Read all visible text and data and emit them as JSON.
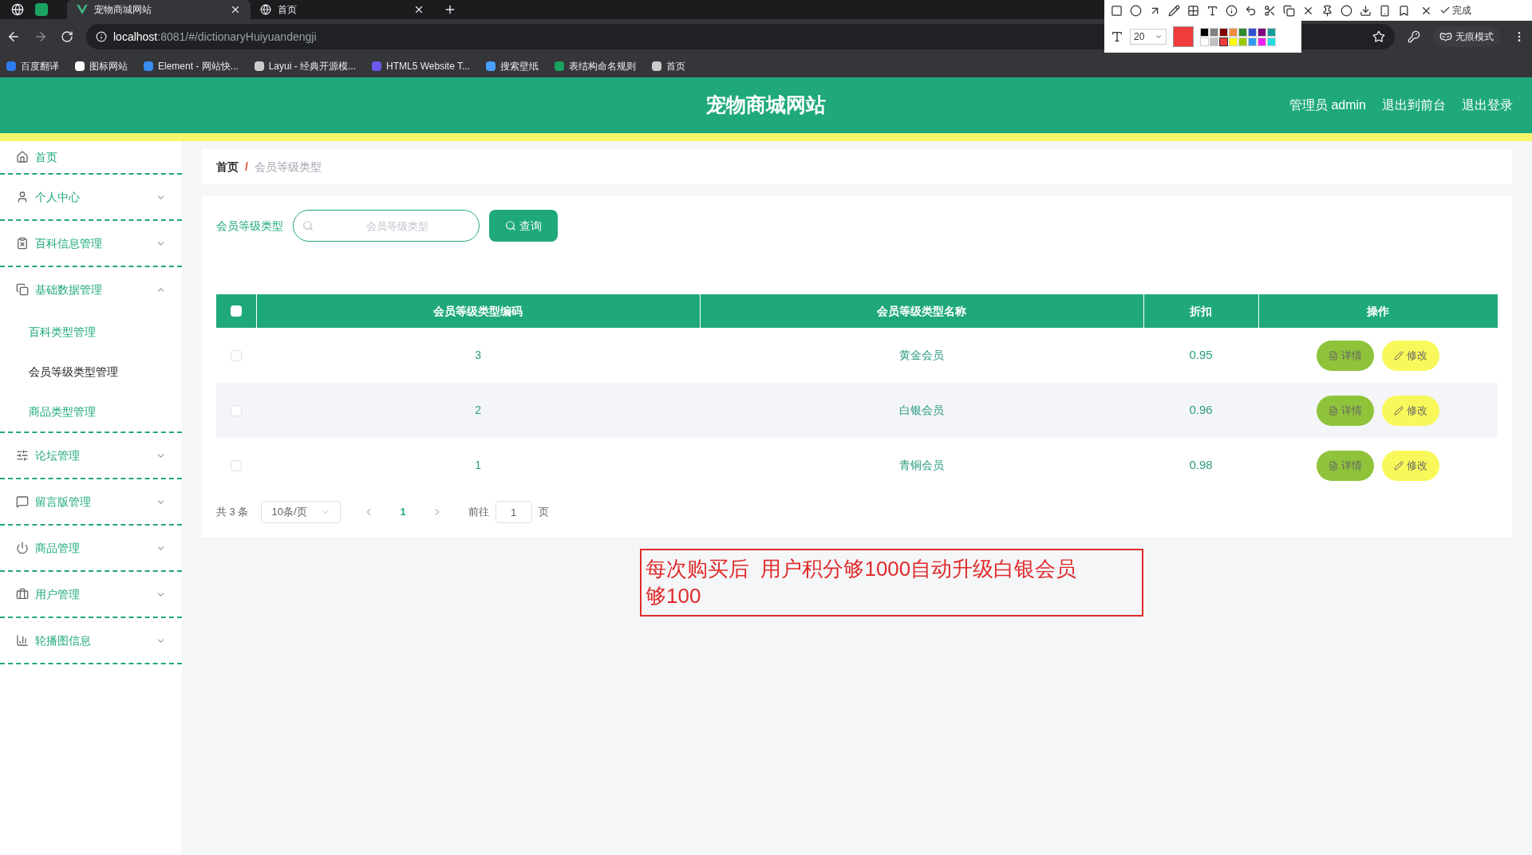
{
  "browser": {
    "tabs": [
      {
        "title": "宠物商城网站",
        "selected": true
      },
      {
        "title": "首页",
        "selected": false
      }
    ],
    "address": {
      "host": "localhost",
      "rest": ":8081/#/dictionaryHuiyuandengji"
    },
    "bookmarks": [
      "百度翻译",
      "图标网站",
      "Element - 网站快...",
      "Layui - 经典开源模...",
      "HTML5 Website T...",
      "搜索壁纸",
      "表结构命名规则",
      "首页"
    ],
    "profile": "无痕模式"
  },
  "capture_tool": {
    "done": "完成",
    "font_size": "20",
    "swatches": [
      {
        "color": "#000000",
        "selected": false
      },
      {
        "color": "#808080",
        "selected": false
      },
      {
        "color": "#800000",
        "selected": false
      },
      {
        "color": "#f28c3c",
        "selected": false
      },
      {
        "color": "#2e8b2e",
        "selected": false
      },
      {
        "color": "#3050d0",
        "selected": false
      },
      {
        "color": "#800080",
        "selected": false
      },
      {
        "color": "#169b9b",
        "selected": false
      },
      {
        "color": "#ffffff",
        "selected": false
      },
      {
        "color": "#c0c0c0",
        "selected": false
      },
      {
        "color": "#f03c3c",
        "selected": true
      },
      {
        "color": "#ffff00",
        "selected": false
      },
      {
        "color": "#99cc00",
        "selected": false
      },
      {
        "color": "#3399ee",
        "selected": false
      },
      {
        "color": "#ee22ee",
        "selected": false
      },
      {
        "color": "#22dddd",
        "selected": false
      }
    ]
  },
  "header": {
    "title": "宠物商城网站",
    "links": [
      "管理员 admin",
      "退出到前台",
      "退出登录"
    ]
  },
  "sidebar": {
    "items": [
      {
        "kind": "link",
        "label": "首页"
      },
      {
        "kind": "menu",
        "label": "个人中心",
        "expanded": false
      },
      {
        "kind": "menu",
        "label": "百科信息管理",
        "expanded": false
      },
      {
        "kind": "menu",
        "label": "基础数据管理",
        "expanded": true,
        "children": [
          {
            "label": "百科类型管理",
            "selected": false
          },
          {
            "label": "会员等级类型管理",
            "selected": true
          },
          {
            "label": "商品类型管理",
            "selected": false
          }
        ]
      },
      {
        "kind": "menu",
        "label": "论坛管理",
        "expanded": false
      },
      {
        "kind": "menu",
        "label": "留言版管理",
        "expanded": false
      },
      {
        "kind": "menu",
        "label": "商品管理",
        "expanded": false
      },
      {
        "kind": "menu",
        "label": "用户管理",
        "expanded": false
      },
      {
        "kind": "menu",
        "label": "轮播图信息",
        "expanded": false
      }
    ]
  },
  "breadcrumb": {
    "separator": "/",
    "items": [
      "首页",
      "会员等级类型"
    ]
  },
  "search": {
    "label": "会员等级类型",
    "placeholder": "会员等级类型",
    "button": "查询"
  },
  "table": {
    "all_checked": false,
    "columns": [
      "会员等级类型编码",
      "会员等级类型名称",
      "折扣",
      "操作"
    ],
    "rows": [
      {
        "checked": false,
        "code": "3",
        "name": "黄金会员",
        "discount": "0.95",
        "actions": [
          "详情",
          "修改"
        ]
      },
      {
        "checked": false,
        "code": "2",
        "name": "白银会员",
        "discount": "0.96",
        "actions": [
          "详情",
          "修改"
        ]
      },
      {
        "checked": false,
        "code": "1",
        "name": "青铜会员",
        "discount": "0.98",
        "actions": [
          "详情",
          "修改"
        ]
      }
    ]
  },
  "pagination": {
    "total": "共 3 条",
    "page_size": "10条/页",
    "pages": [
      {
        "label": "1",
        "selected": true
      }
    ],
    "goto": "前往",
    "goto_value": "1",
    "page_unit": "页"
  },
  "annotation": {
    "lines": [
      "每次购买后  用户积分够1000自动升级白银会员",
      "够100"
    ]
  }
}
